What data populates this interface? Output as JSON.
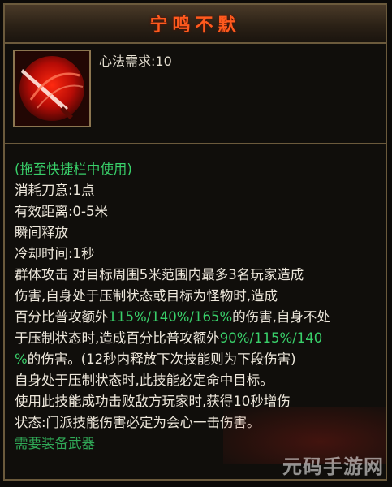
{
  "title": "宁鸣不默",
  "requirement": "心法需求:10",
  "usage_hint": "(拖至快捷栏中使用)",
  "lines": [
    "消耗刀意:1点",
    "有效距离:0-5米",
    "瞬间释放",
    "冷却时间:1秒"
  ],
  "description": {
    "l1": "群体攻击 对目标周围5米范围内最多3名玩家造成",
    "l2": "伤害,自身处于压制状态或目标为怪物时,造成",
    "l3a": "百分比普攻额外",
    "l3b": "115%/140%/165%",
    "l3c": "的伤害,自身不处",
    "l4a": "于压制状态时,造成百分比普攻额外",
    "l4b": "90%/115%/140",
    "l5a": "%",
    "l5b": "的伤害。(12秒内释放下次技能则为下段伤害)",
    "l6": "自身处于压制状态时,此技能必定命中目标。",
    "l7": "使用此技能成功击败敌方玩家时,获得10秒增伤",
    "l8": "状态:门派技能伤害必定为会心一击伤害。"
  },
  "footer": "需要装备武器",
  "watermark": "元码手游网",
  "colors": {
    "title": "#ff5a1e",
    "highlight": "#39d06a",
    "border": "#6b5a3c"
  },
  "icon": "red-slash-skill-icon"
}
